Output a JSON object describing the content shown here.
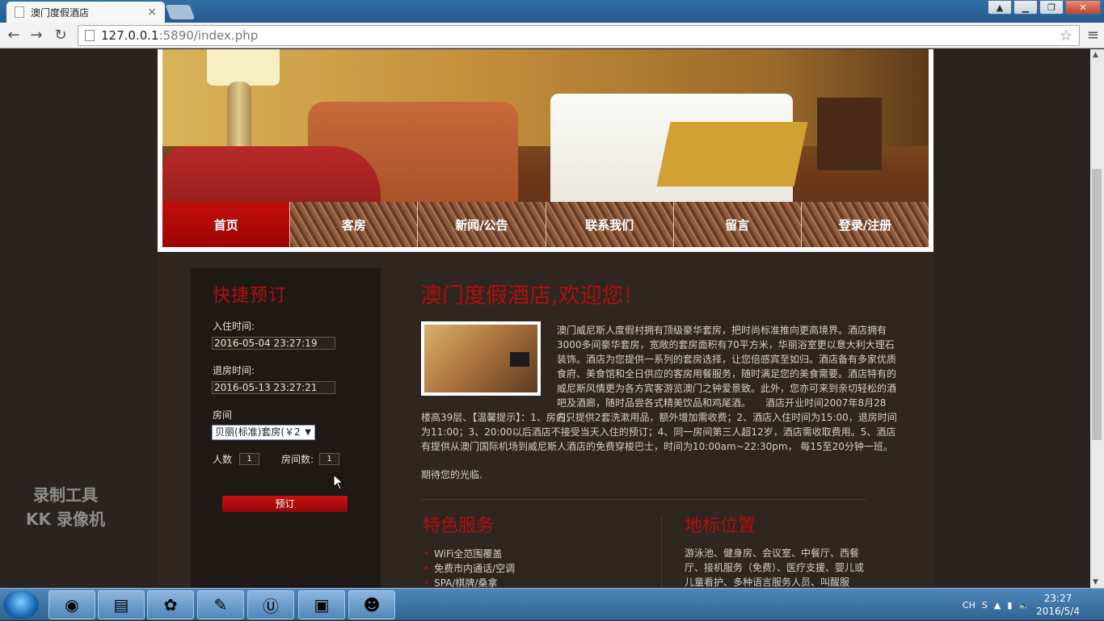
{
  "browser": {
    "tab_title": "澳门度假酒店",
    "url_host": "127.0.0.1",
    "url_rest": ":5890/index.php",
    "close_tab": "×"
  },
  "nav": {
    "items": [
      "首页",
      "客房",
      "新闻/公告",
      "联系我们",
      "留言",
      "登录/注册"
    ]
  },
  "sidebar": {
    "title": "快捷预订",
    "checkin_label": "入住时间:",
    "checkin_value": "2016-05-04 23:27:19",
    "checkout_label": "退房时间:",
    "checkout_value": "2016-05-13 23:27:21",
    "room_label": "房间",
    "room_selected": "贝丽(标准)套房(￥2",
    "people_label": "人数",
    "people_value": "1",
    "rooms_label": "房间数:",
    "rooms_value": "1",
    "book_button": "预订"
  },
  "main": {
    "title": "澳门度假酒店,欢迎您!",
    "intro_side": "澳门威尼斯人度假村拥有顶级豪华套房，把时尚标准推向更高境界。酒店拥有3000多间豪华套房，宽敞的套房面积有70平方米，华丽浴室更以意大利大理石装饰。酒店为您提供一系列的套房选择，让您倍感宾至如归。酒店备有多家优质食府、美食馆和全日供应的客房用餐服务，随时满足您的美食需要。酒店特有的威尼斯风情更为各方宾客游览澳门之钟爱景致。此外，您亦可来到亲切轻松的酒吧及酒廊，随时品尝各式精美饮品和鸡尾酒。　　酒店开业时间2007年8月28日，",
    "intro_full": "楼高39层、【温馨提示】：1、房内只提供2套洗漱用品，额外增加需收费；2、酒店入住时间为15:00，退房时间为11:00；3、20:00以后酒店不接受当天入住的预订；4、同一房间第三人超12岁，酒店需收取费用。5、酒店有提供从澳门国际机场到威尼斯人酒店的免费穿梭巴士，时间为10:00am~22:30pm， 每15至20分钟一班。",
    "closing": "期待您的光临."
  },
  "services": {
    "title": "特色服务",
    "items": [
      "WiFi全范围覆盖",
      "免费市内通话/空调",
      "SPA/棋牌/桑拿"
    ]
  },
  "location": {
    "title": "地标位置",
    "text": "游泳池、健身房、会议室、中餐厅、西餐厅、接机服务（免费）、医疗支援、婴儿或儿童看护、多种语言服务人员、叫醒服"
  },
  "watermark": {
    "line1": "录制工具",
    "line2": "KK 录像机"
  },
  "taskbar": {
    "lang": "CH",
    "time": "23:27",
    "date": "2016/5/4"
  },
  "colors": {
    "accent_red": "#b10f0f",
    "page_bg": "#2b241e",
    "sidebar_bg": "#1f1915"
  }
}
